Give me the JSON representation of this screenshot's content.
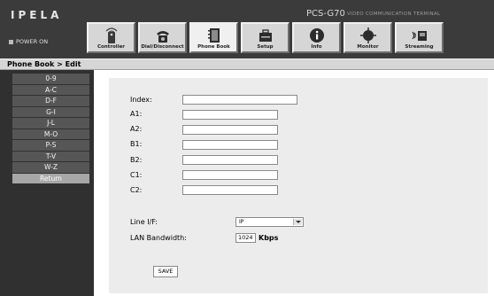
{
  "header": {
    "logo": "IPELA",
    "model": "PCS-G70",
    "model_subtitle": "VIDEO COMMUNICATION TERMINAL",
    "power_status": "POWER ON"
  },
  "tabs": [
    {
      "label": "Controller",
      "icon": "remote-control-icon"
    },
    {
      "label": "Dial/Disconnect",
      "icon": "telephone-icon"
    },
    {
      "label": "Phone Book",
      "icon": "phone-book-icon",
      "active": true
    },
    {
      "label": "Setup",
      "icon": "toolbox-icon"
    },
    {
      "label": "Info",
      "icon": "info-icon"
    },
    {
      "label": "Monitor",
      "icon": "monitor-icon"
    },
    {
      "label": "Streaming",
      "icon": "streaming-icon"
    }
  ],
  "breadcrumb": "Phone Book > Edit",
  "sidebar": {
    "items": [
      "0-9",
      "A-C",
      "D-F",
      "G-I",
      "J-L",
      "M-O",
      "P-S",
      "T-V",
      "W-Z",
      "Return"
    ],
    "selected": "Return"
  },
  "form": {
    "index": {
      "label": "Index:",
      "value": ""
    },
    "a1": {
      "label": "A1:",
      "value": ""
    },
    "a2": {
      "label": "A2:",
      "value": ""
    },
    "b1": {
      "label": "B1:",
      "value": ""
    },
    "b2": {
      "label": "B2:",
      "value": ""
    },
    "c1": {
      "label": "C1:",
      "value": ""
    },
    "c2": {
      "label": "C2:",
      "value": ""
    },
    "line_if": {
      "label": "Line I/F:",
      "value": "IP"
    },
    "lan_bandwidth": {
      "label": "LAN Bandwidth:",
      "value": "1024",
      "unit": "Kbps"
    },
    "save_label": "SAVE"
  }
}
